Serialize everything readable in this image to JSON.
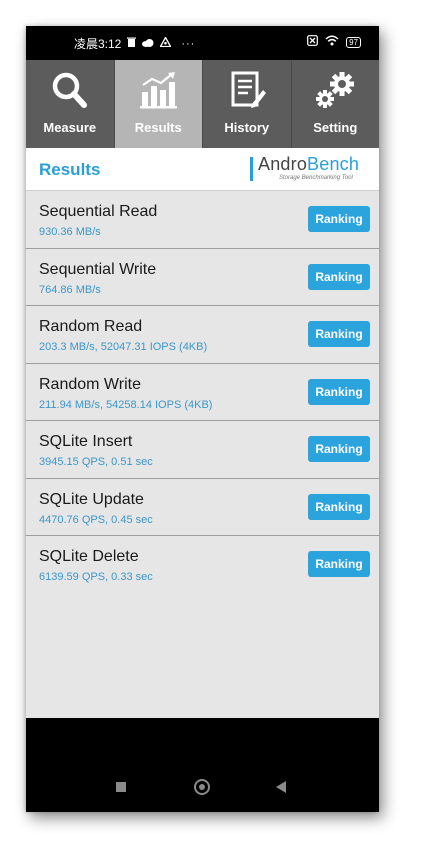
{
  "status_bar": {
    "time": "凌晨3:12",
    "icons_left": [
      "trash-icon",
      "cloud-icon",
      "recycle-icon",
      "more-icon"
    ],
    "more": "···",
    "icons_right": [
      "sim-off-icon",
      "wifi-icon",
      "battery-icon"
    ],
    "battery": "97"
  },
  "tabs": [
    {
      "label": "Measure",
      "icon": "search-icon",
      "active": false
    },
    {
      "label": "Results",
      "icon": "bar-chart-icon",
      "active": true
    },
    {
      "label": "History",
      "icon": "document-icon",
      "active": false
    },
    {
      "label": "Setting",
      "icon": "gear-icon",
      "active": false
    }
  ],
  "header": {
    "title": "Results",
    "logo_part1": "Andro",
    "logo_part2": "Bench",
    "logo_subtitle": "Storage Benchmarking Tool"
  },
  "results": [
    {
      "title": "Sequential Read",
      "value": "930.36 MB/s",
      "button": "Ranking"
    },
    {
      "title": "Sequential Write",
      "value": "764.86 MB/s",
      "button": "Ranking"
    },
    {
      "title": "Random Read",
      "value": "203.3 MB/s, 52047.31 IOPS (4KB)",
      "button": "Ranking"
    },
    {
      "title": "Random Write",
      "value": "211.94 MB/s, 54258.14 IOPS (4KB)",
      "button": "Ranking"
    },
    {
      "title": "SQLite Insert",
      "value": "3945.15 QPS, 0.51 sec",
      "button": "Ranking"
    },
    {
      "title": "SQLite Update",
      "value": "4470.76 QPS, 0.45 sec",
      "button": "Ranking"
    },
    {
      "title": "SQLite Delete",
      "value": "6139.59 QPS, 0.33 sec",
      "button": "Ranking"
    }
  ],
  "system_nav": [
    "recents-button",
    "home-button",
    "back-button"
  ],
  "colors": {
    "accent": "#2ba3dd",
    "tab_bg": "#5c5c5c",
    "tab_active": "#b5b5b5",
    "list_bg": "#e6e6e6"
  }
}
